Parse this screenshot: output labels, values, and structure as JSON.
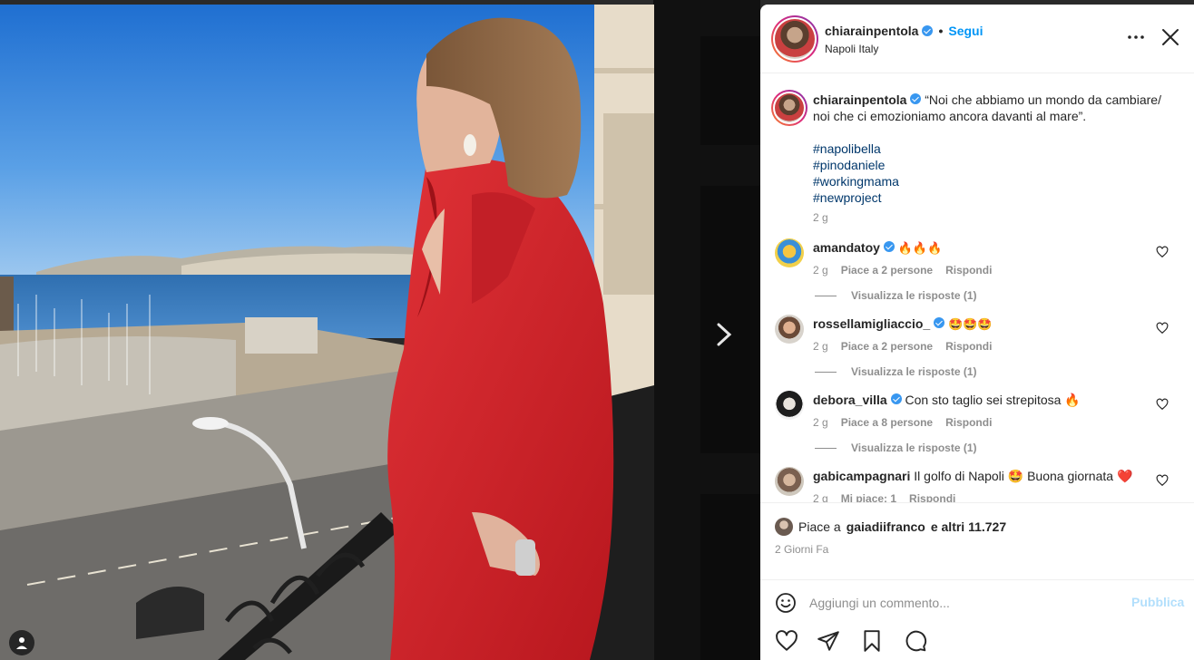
{
  "post": {
    "username": "chiarainpentola",
    "follow_label": "Segui",
    "separator": "•",
    "location": "Napoli Italy",
    "caption": "“Noi che abbiamo un mondo da cambiare/ noi che ci emozioniamo ancora davanti al mare”.",
    "hashtags": [
      "#napolibella",
      "#pinodaniele",
      "#workingmama",
      "#newproject"
    ],
    "caption_time": "2 g"
  },
  "comments": [
    {
      "username": "amandatoy",
      "text": "🔥🔥🔥",
      "time": "2 g",
      "likes": "Piace a 2 persone",
      "reply": "Rispondi",
      "view_replies": "Visualizza le risposte (1)"
    },
    {
      "username": "rossellamigliaccio_",
      "text": "🤩🤩🤩",
      "time": "2 g",
      "likes": "Piace a 2 persone",
      "reply": "Rispondi",
      "view_replies": "Visualizza le risposte (1)"
    },
    {
      "username": "debora_villa",
      "text": "Con sto taglio sei strepitosa 🔥",
      "time": "2 g",
      "likes": "Piace a 8 persone",
      "reply": "Rispondi",
      "view_replies": "Visualizza le risposte (1)"
    },
    {
      "username": "gabicampagnari",
      "text": "Il golfo di Napoli 🤩 Buona giornata ❤️",
      "time": "2 g",
      "likes": "Mi piace: 1",
      "reply": "Rispondi"
    }
  ],
  "likes": {
    "prefix": "Piace a",
    "user": "gaiadiifranco",
    "suffix": "e altri 11.727"
  },
  "post_date": "2 Giorni Fa",
  "add_comment": {
    "placeholder": "Aggiungi un commento...",
    "publish_label": "Pubblica"
  },
  "colors": {
    "accent_blue": "#0095f6",
    "hashtag": "#00376b",
    "muted": "#8e8e8e",
    "publish_disabled": "#b2dffc"
  },
  "icons": [
    "more-options-icon",
    "close-icon",
    "verified-badge-icon",
    "heart-icon",
    "share-icon",
    "bookmark-icon",
    "comment-icon",
    "emoji-icon",
    "chevron-right-icon",
    "user-tag-icon"
  ]
}
